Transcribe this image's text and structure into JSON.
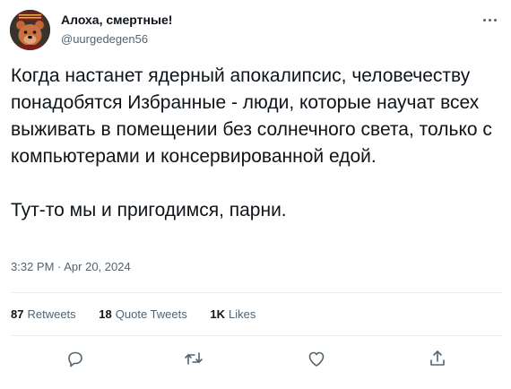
{
  "author": {
    "name": "Алоха, смертные!",
    "handle": "@uurgedegen56",
    "avatar_icon": "bear-avatar-icon"
  },
  "tweet": {
    "paragraphs": [
      "Когда настанет ядерный апокалипсис, человечеству понадобятся Избранные - люди, которые научат всех выживать в помещении без солнечного света, только с компьютерами и консервированной едой.",
      "Тут-то мы и пригодимся, парни."
    ],
    "timestamp": "3:32 PM · Apr 20, 2024"
  },
  "stats": {
    "retweets_count": "87",
    "retweets_label": "Retweets",
    "quotes_count": "18",
    "quotes_label": "Quote Tweets",
    "likes_count": "1K",
    "likes_label": "Likes"
  },
  "actions": {
    "icons": [
      "reply-icon",
      "retweet-icon",
      "like-icon",
      "share-icon"
    ]
  },
  "colors": {
    "text": "#0f1419",
    "secondary": "#536471",
    "divider": "#e6ecf0"
  }
}
